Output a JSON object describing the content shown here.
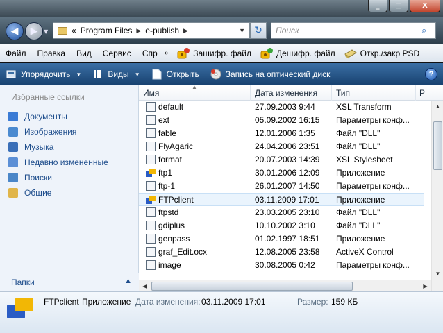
{
  "window": {
    "minimize": "_",
    "maximize": "□",
    "close": "X"
  },
  "address": {
    "prefix": "«",
    "crumbs": [
      "Program Files",
      "e-publish"
    ],
    "search_placeholder": "Поиск"
  },
  "menu": {
    "items": [
      "Файл",
      "Правка",
      "Вид",
      "Сервис",
      "Спр"
    ],
    "tools": [
      {
        "label": "Зашифр. файл",
        "icon": "encrypt-icon"
      },
      {
        "label": "Дешифр. файл",
        "icon": "decrypt-icon"
      },
      {
        "label": "Откр./закр PSD",
        "icon": "disk-icon"
      }
    ]
  },
  "commands": {
    "organize": "Упорядочить",
    "views": "Виды",
    "open": "Открыть",
    "burn": "Запись на оптический диск"
  },
  "nav": {
    "header": "Избранные ссылки",
    "items": [
      {
        "label": "Документы",
        "color": "#3a7bd5"
      },
      {
        "label": "Изображения",
        "color": "#4a8ad0"
      },
      {
        "label": "Музыка",
        "color": "#3a6fb8"
      },
      {
        "label": "Недавно измененные",
        "color": "#5b8fd6"
      },
      {
        "label": "Поиски",
        "color": "#4a86c8"
      },
      {
        "label": "Общие",
        "color": "#e0b54a"
      }
    ],
    "folders": "Папки"
  },
  "columns": {
    "name": "Имя",
    "date": "Дата изменения",
    "type": "Тип",
    "more": "Р"
  },
  "files": [
    {
      "name": "default",
      "date": "27.09.2003 9:44",
      "type": "XSL Transform",
      "icon": "xsl-icon"
    },
    {
      "name": "ext",
      "date": "05.09.2002 16:15",
      "type": "Параметры конф...",
      "icon": "config-icon"
    },
    {
      "name": "fable",
      "date": "12.01.2006 1:35",
      "type": "Файл \"DLL\"",
      "icon": "dll-icon"
    },
    {
      "name": "FlyAgaric",
      "date": "24.04.2006 23:51",
      "type": "Файл \"DLL\"",
      "icon": "dll-icon"
    },
    {
      "name": "format",
      "date": "20.07.2003 14:39",
      "type": "XSL Stylesheet",
      "icon": "xsl-icon"
    },
    {
      "name": "ftp1",
      "date": "30.01.2006 12:09",
      "type": "Приложение",
      "icon": "app-icon"
    },
    {
      "name": "ftp-1",
      "date": "26.01.2007 14:50",
      "type": "Параметры конф...",
      "icon": "config-icon"
    },
    {
      "name": "FTPclient",
      "date": "03.11.2009 17:01",
      "type": "Приложение",
      "icon": "app-icon",
      "selected": true
    },
    {
      "name": "ftpstd",
      "date": "23.03.2005 23:10",
      "type": "Файл \"DLL\"",
      "icon": "dll-icon"
    },
    {
      "name": "gdiplus",
      "date": "10.10.2002 3:10",
      "type": "Файл \"DLL\"",
      "icon": "dll-icon"
    },
    {
      "name": "genpass",
      "date": "01.02.1997 18:51",
      "type": "Приложение",
      "icon": "app-icon"
    },
    {
      "name": "graf_Edit.ocx",
      "date": "12.08.2005 23:58",
      "type": "ActiveX Control",
      "icon": "ocx-icon"
    },
    {
      "name": "image",
      "date": "30.08.2005 0:42",
      "type": "Параметры конф...",
      "icon": "config-icon"
    }
  ],
  "details": {
    "name": "FTPclient",
    "type": "Приложение",
    "date_label": "Дата изменения:",
    "date_value": "03.11.2009 17:01",
    "size_label": "Размер:",
    "size_value": "159 КБ"
  }
}
